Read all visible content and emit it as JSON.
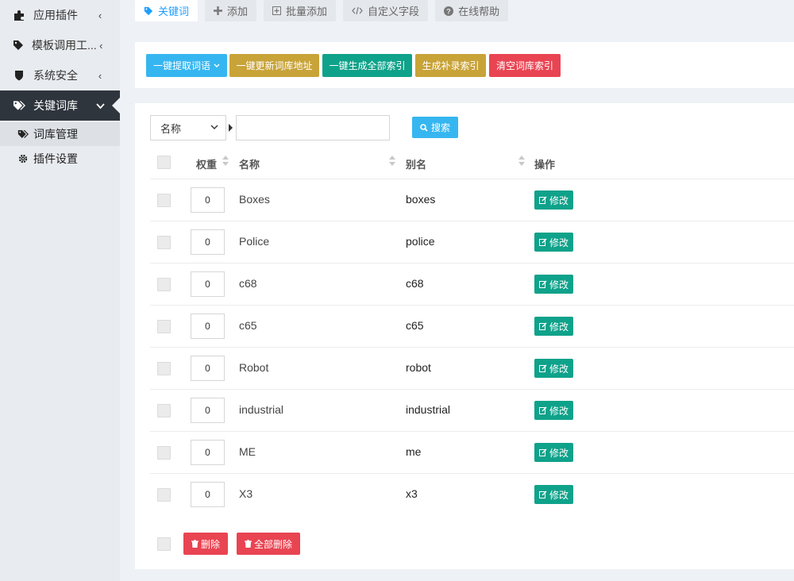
{
  "sidebar": {
    "items": [
      {
        "label": "应用插件",
        "icon": "puzzle-icon"
      },
      {
        "label": "模板调用工...",
        "icon": "tag-icon"
      },
      {
        "label": "系统安全",
        "icon": "shield-icon"
      },
      {
        "label": "关键词库",
        "icon": "tags-icon"
      }
    ],
    "subitems": [
      {
        "label": "词库管理",
        "icon": "tags-icon"
      },
      {
        "label": "插件设置",
        "icon": "gear-icon"
      }
    ]
  },
  "tabs": [
    {
      "label": "关键词",
      "icon": "tag-icon"
    },
    {
      "label": "添加",
      "icon": "plus-icon"
    },
    {
      "label": "批量添加",
      "icon": "plus-square-icon"
    },
    {
      "label": "自定义字段",
      "icon": "code-icon"
    },
    {
      "label": "在线帮助",
      "icon": "question-circle-icon"
    }
  ],
  "actions": {
    "extract": "一键提取词语",
    "update_url": "一键更新词库地址",
    "gen_all": "一键生成全部索引",
    "gen_patch": "生成补录索引",
    "clear": "清空词库索引"
  },
  "search": {
    "field_value": "名称",
    "input_value": "",
    "button_label": "搜索"
  },
  "table": {
    "headers": {
      "weight": "权重",
      "name": "名称",
      "alias": "别名",
      "ops": "操作"
    },
    "edit_label": "修改",
    "rows": [
      {
        "weight": "0",
        "name": "Boxes",
        "alias": "boxes"
      },
      {
        "weight": "0",
        "name": "Police",
        "alias": "police"
      },
      {
        "weight": "0",
        "name": "c68",
        "alias": "c68"
      },
      {
        "weight": "0",
        "name": "c65",
        "alias": "c65"
      },
      {
        "weight": "0",
        "name": "Robot",
        "alias": "robot"
      },
      {
        "weight": "0",
        "name": "industrial",
        "alias": "industrial"
      },
      {
        "weight": "0",
        "name": "ME",
        "alias": "me"
      },
      {
        "weight": "0",
        "name": "X3",
        "alias": "x3"
      }
    ]
  },
  "footer": {
    "delete_label": "删除",
    "delete_all_label": "全部删除"
  },
  "colors": {
    "active_tab": "#1e9fff",
    "btn_blue": "#36b6f0",
    "btn_gold": "#c8a338",
    "btn_teal": "#0fa28a",
    "btn_red": "#e94452",
    "sidebar_active": "#2f353d"
  }
}
